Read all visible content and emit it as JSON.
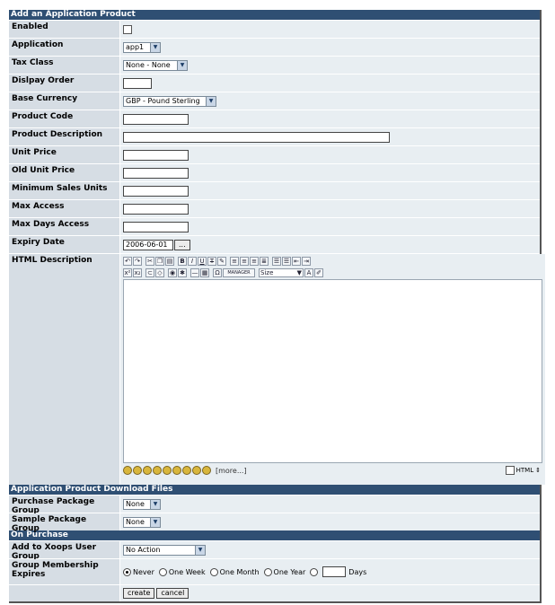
{
  "section_main": {
    "title": "Add an Application Product"
  },
  "fields": {
    "enabled": {
      "label": "Enabled",
      "checked": false
    },
    "application": {
      "label": "Application",
      "value": "app1"
    },
    "tax_class": {
      "label": "Tax Class",
      "value": "None - None"
    },
    "display_order": {
      "label": "Dislpay Order",
      "value": ""
    },
    "base_currency": {
      "label": "Base Currency",
      "value": "GBP - Pound Sterling"
    },
    "product_code": {
      "label": "Product Code",
      "value": ""
    },
    "product_description": {
      "label": "Product Description",
      "value": ""
    },
    "unit_price": {
      "label": "Unit Price",
      "value": ""
    },
    "old_unit_price": {
      "label": "Old Unit Price",
      "value": ""
    },
    "min_sales_units": {
      "label": "Minimum Sales Units",
      "value": ""
    },
    "max_access": {
      "label": "Max Access",
      "value": ""
    },
    "max_days_access": {
      "label": "Max Days Access",
      "value": ""
    },
    "expiry_date": {
      "label": "Expiry Date",
      "value": "2006-06-01",
      "picker_label": "..."
    },
    "html_description": {
      "label": "HTML Description",
      "size_label": "Size",
      "manager_label": "MANAGER",
      "more_label": "[more...]",
      "html_toggle_label": "HTML"
    }
  },
  "section_download": {
    "title": "Application Product Download Files"
  },
  "download": {
    "purchase_package": {
      "label": "Purchase Package Group",
      "value": "None"
    },
    "sample_package": {
      "label": "Sample Package Group",
      "value": "None"
    }
  },
  "section_purchase": {
    "title": "On Purchase"
  },
  "purchase": {
    "xoops_group": {
      "label": "Add to Xoops User Group",
      "value": "No Action"
    },
    "membership_expires": {
      "label": "Group Membership Expires",
      "options": [
        "Never",
        "One Week",
        "One Month",
        "One Year"
      ],
      "selected": "Never",
      "days_label": "Days"
    }
  },
  "buttons": {
    "create": "create",
    "cancel": "cancel"
  },
  "icons": [
    "undo-icon",
    "redo-icon",
    "cut-icon",
    "copy-icon",
    "paste-icon",
    "bold-icon",
    "italic-icon",
    "underline-icon",
    "strikethrough-icon",
    "color-icon"
  ],
  "colors": {
    "header_bg": "#2f4f73",
    "label_bg": "#d6dde4",
    "field_bg": "#e8eef2"
  }
}
